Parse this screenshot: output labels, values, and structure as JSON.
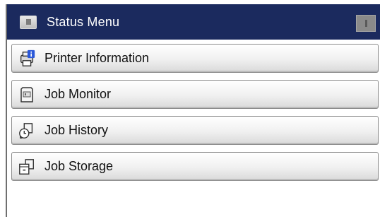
{
  "title_bar": {
    "title": "Status Menu",
    "menu_icon": "menu-icon",
    "right_icon": "indicator-icon"
  },
  "menu": {
    "items": [
      {
        "label": "Printer Information",
        "icon": "printer-info-icon"
      },
      {
        "label": "Job Monitor",
        "icon": "job-monitor-icon"
      },
      {
        "label": "Job History",
        "icon": "job-history-icon"
      },
      {
        "label": "Job Storage",
        "icon": "job-storage-icon"
      }
    ]
  },
  "colors": {
    "title_bar_bg": "#1b2a5e",
    "title_text": "#ffffff",
    "button_border": "#8c8c8c",
    "info_badge": "#2b58d8"
  }
}
